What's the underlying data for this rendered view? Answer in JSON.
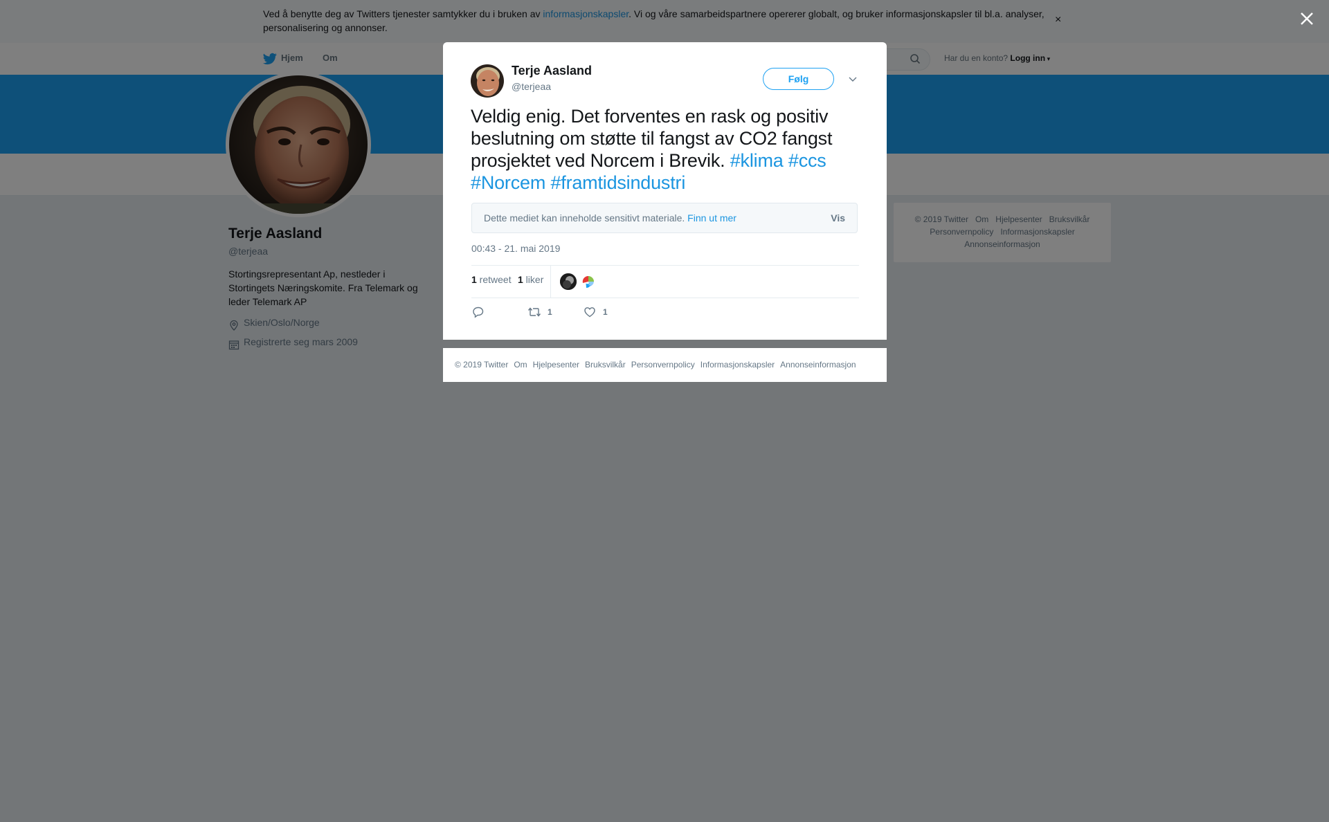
{
  "cookie_banner": {
    "text_before": "Ved å benytte deg av Twitters tjenester samtykker du i bruken av ",
    "link": "informasjonskapsler",
    "text_after": ". Vi og våre samarbeidspartnere opererer globalt, og bruker informasjonskapsler til bl.a. analyser, personalisering og annonser.",
    "close": "×"
  },
  "nav": {
    "home": "Hjem",
    "about": "Om",
    "have_account": "Har du en konto?",
    "login": "Logg inn"
  },
  "profile": {
    "name": "Terje Aasland",
    "handle": "@terjeaa",
    "bio": "Stortingsrepresentant Ap, nestleder i Stortingets Næringskomite. Fra Telemark og leder Telemark AP",
    "location": "Skien/Oslo/Norge",
    "joined": "Registrerte seg mars 2009"
  },
  "side_footer": [
    "© 2019 Twitter",
    "Om",
    "Hjelpesenter",
    "Bruksvilkår",
    "Personvernpolicy",
    "Informasjonskapsler",
    "Annonseinformasjon"
  ],
  "tweet": {
    "author_name": "Terje Aasland",
    "author_handle": "@terjeaa",
    "follow": "Følg",
    "text": "Veldig enig. Det forventes en rask og positiv beslutning om støtte til fangst av CO2 fangst prosjektet ved Norcem i Brevik. ",
    "hashtags": [
      "#klima",
      "#ccs",
      "#Norcem",
      "#framtidsindustri"
    ],
    "sensitive_text": "Dette mediet kan inneholde sensitivt materiale. ",
    "sensitive_link": "Finn ut mer",
    "sensitive_show": "Vis",
    "timestamp": "00:43 - 21. mai 2019",
    "retweets": "1",
    "retweets_label": " retweet",
    "likes": "1",
    "likes_label": " liker",
    "action_retweets": "1",
    "action_likes": "1"
  },
  "modal_footer": [
    "© 2019 Twitter",
    "Om",
    "Hjelpesenter",
    "Bruksvilkår",
    "Personvernpolicy",
    "Informasjonskapsler",
    "Annonseinformasjon"
  ],
  "colors": {
    "accent": "#1da1f2",
    "link": "#1b95e0",
    "overlay": "rgba(0,0,0,0.5)"
  }
}
